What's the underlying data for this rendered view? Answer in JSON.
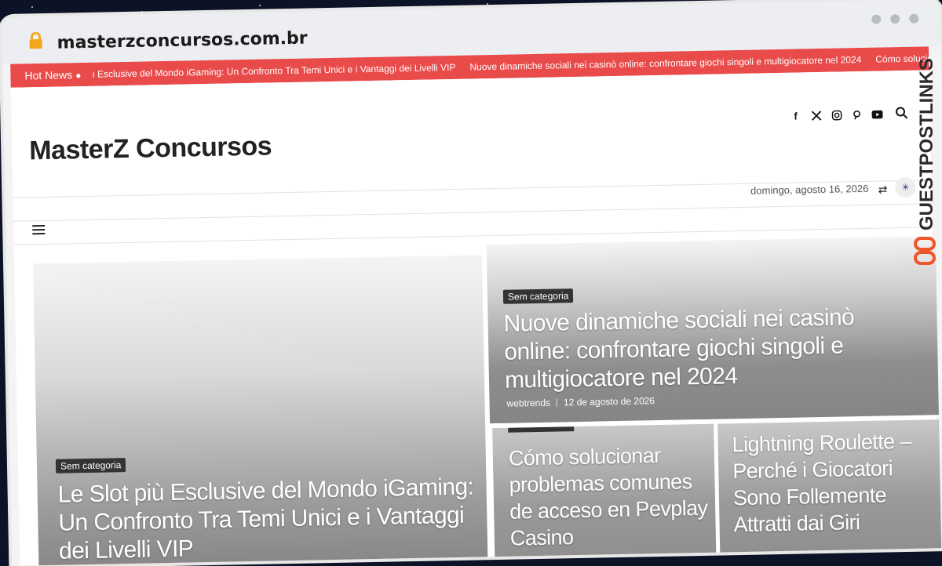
{
  "browser": {
    "url": "masterzconcursos.com.br"
  },
  "ticker": {
    "label": "Hot News",
    "items": [
      "ı Esclusive del Mondo iGaming: Un Confronto Tra Temi Unici e i Vantaggi dei Livelli VIP",
      "Nuove dinamiche sociali nei casinò online: confrontare giochi singoli e multigiocatore nel 2024",
      "Cómo solucionar probl"
    ]
  },
  "site": {
    "logo": "MasterZ Concursos",
    "date": "domingo, agosto 16, 2026"
  },
  "posts": {
    "big": {
      "category": "Sem categoria",
      "title": "Le Slot più Esclusive del Mondo iGaming: Un Confronto Tra Temi Unici e i Vantaggi dei Livelli VIP"
    },
    "right": {
      "category": "Sem categoria",
      "title": "Nuove dinamiche sociali nei casinò online: confrontare giochi singoli e multigiocatore nel 2024",
      "author": "webtrends",
      "date": "12 de agosto de 2026"
    },
    "small1": {
      "title": "Cómo solucionar problemas comunes de acceso en Pevplay Casino"
    },
    "small2": {
      "title": "Lightning Roulette – Perché i Giocatori Sono Follemente Attratti dai Giri"
    }
  },
  "watermark": {
    "text": "GUESTPOSTLINKS"
  },
  "colors": {
    "ticker_bg": "#e94a4a",
    "lock": "#f2a81d",
    "watermark": "#2b2b2b",
    "watermark_accent": "#f0562b"
  }
}
